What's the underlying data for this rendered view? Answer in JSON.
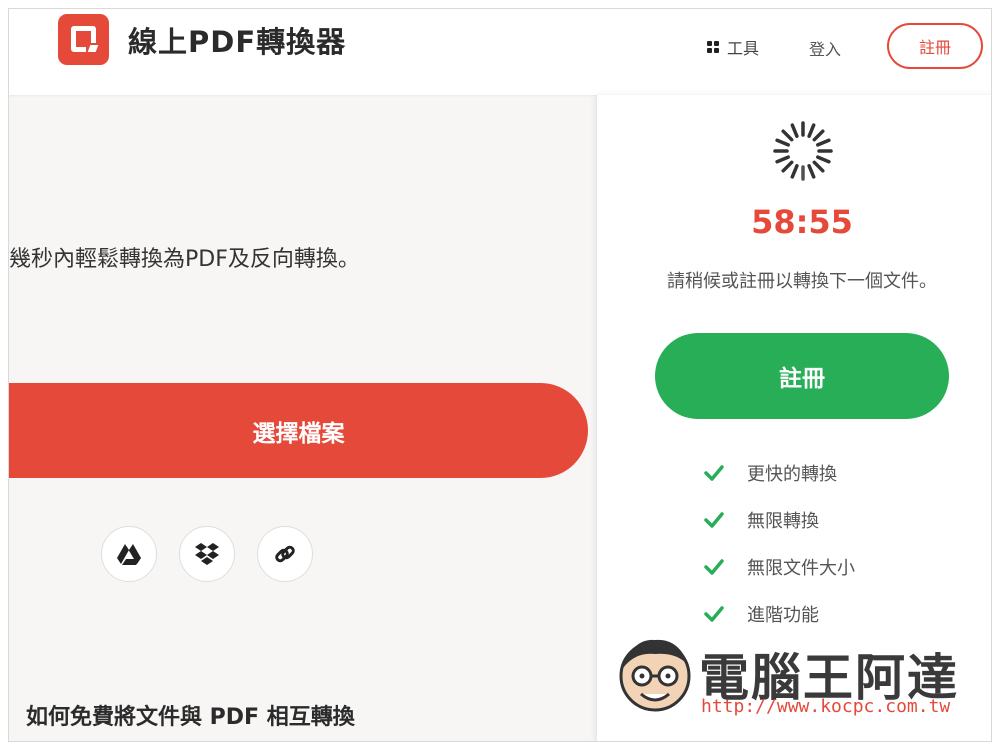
{
  "header": {
    "app_title": "線上PDF轉換器",
    "tools_label": "工具",
    "login_label": "登入",
    "register_label": "註冊"
  },
  "main": {
    "subtitle": "幾秒內輕鬆轉換為PDF及反向轉換。",
    "choose_file_label": "選擇檔案",
    "sources": [
      "google-drive-icon",
      "dropbox-icon",
      "link-icon"
    ],
    "bottom_heading": "如何免費將文件與 PDF 相互轉換"
  },
  "panel": {
    "timer": "58:55",
    "wait_text": "請稍候或註冊以轉換下一個文件。",
    "register_label": "註冊",
    "features": [
      "更快的轉換",
      "無限轉換",
      "無限文件大小",
      "進階功能"
    ]
  },
  "watermark": {
    "title": "電腦王阿達",
    "url": "http://www.kocpc.com.tw"
  },
  "colors": {
    "brand_red": "#e5493a",
    "green": "#27ae57"
  }
}
